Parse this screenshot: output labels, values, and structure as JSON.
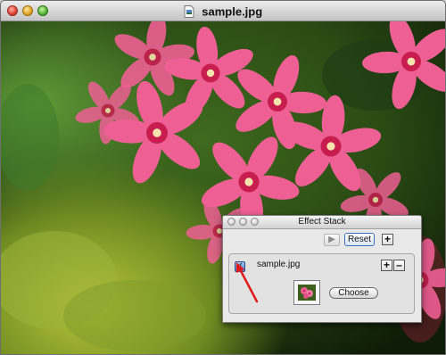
{
  "window": {
    "title": "sample.jpg",
    "title_icon": "jpeg-document-icon",
    "controls": [
      "close-icon",
      "minimize-icon",
      "zoom-icon"
    ]
  },
  "photo": {
    "subject_icon": "pink-phlox-flowers-photo"
  },
  "effect_stack": {
    "title": "Effect Stack",
    "play_icon": "▶",
    "reset_label": "Reset",
    "add_label": "+",
    "layer": {
      "checked": true,
      "check_mark": "✓",
      "name": "sample.jpg",
      "add_label": "+",
      "remove_label": "–",
      "thumbnail_icon": "flower-thumbnail-icon",
      "choose_label": "Choose"
    }
  },
  "annotation": {
    "arrow_color": "#e01b1b"
  }
}
